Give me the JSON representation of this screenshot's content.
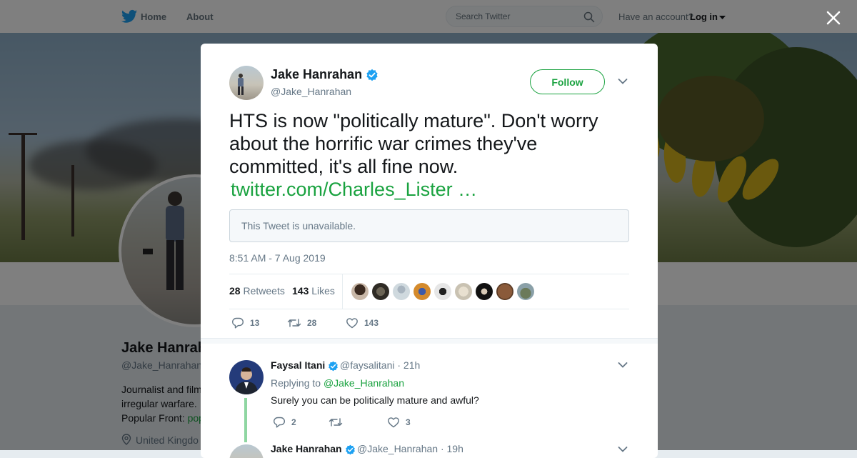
{
  "nav": {
    "home": "Home",
    "about": "About",
    "search_placeholder": "Search Twitter",
    "account_question": "Have an account?",
    "login": "Log in"
  },
  "background_profile": {
    "name": "Jake Hanrah",
    "handle": "@Jake_Hanrahan",
    "bio_line1": "Journalist and film",
    "bio_line2": "irregular warfare. .",
    "bio_line3_prefix": "Popular Front: ",
    "bio_line3_link": "pop",
    "location": "United Kingdo"
  },
  "tweet": {
    "author_name": "Jake Hanrahan",
    "author_handle": "@Jake_Hanrahan",
    "follow_label": "Follow",
    "text": "HTS is now \"politically mature\". Don't worry about the horrific war crimes they've committed, it's all fine now.",
    "link": "twitter.com/Charles_Lister …",
    "quote_unavailable": "This Tweet is unavailable.",
    "timestamp": "8:51 AM - 7 Aug 2019",
    "retweets_count": "28",
    "retweets_label": "Retweets",
    "likes_count": "143",
    "likes_label": "Likes",
    "replies_action": "13",
    "retweets_action": "28",
    "likes_action": "143"
  },
  "reply": {
    "name": "Faysal Itani",
    "meta": "@faysalitani · 21h",
    "replying_prefix": "Replying to ",
    "replying_to": "@Jake_Hanrahan",
    "text": "Surely you can be politically mature and awful?",
    "replies": "2",
    "likes": "3"
  },
  "reply2": {
    "name": "Jake Hanrahan",
    "meta": "@Jake_Hanrahan · 19h"
  },
  "colors": {
    "accent": "#19a23f",
    "verified": "#1da1f2",
    "brand": "#1da1f2"
  }
}
